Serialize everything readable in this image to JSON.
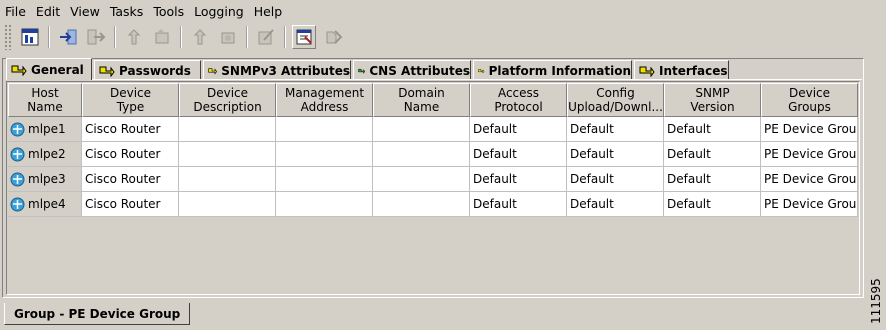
{
  "menu": [
    "File",
    "Edit",
    "View",
    "Tasks",
    "Tools",
    "Logging",
    "Help"
  ],
  "toolbar": {
    "buttons": [
      {
        "icon": "device-properties-icon",
        "enabled": true
      },
      {
        "icon": "import-icon",
        "enabled": true
      },
      {
        "icon": "export-icon",
        "enabled": false
      },
      {
        "icon": "upload-icon",
        "enabled": false
      },
      {
        "icon": "upload-config-icon",
        "enabled": false
      },
      {
        "icon": "deploy-icon",
        "enabled": false
      },
      {
        "icon": "deploy-config-icon",
        "enabled": false
      },
      {
        "icon": "edit-icon",
        "enabled": false
      },
      {
        "icon": "group-properties-icon",
        "enabled": true
      },
      {
        "icon": "collect-icon",
        "enabled": false
      }
    ]
  },
  "tabs": [
    "General",
    "Passwords",
    "SNMPv3 Attributes",
    "CNS Attributes",
    "Platform Information",
    "Interfaces"
  ],
  "selected_tab": "General",
  "table": {
    "headers": [
      [
        "Host",
        "Name"
      ],
      [
        "Device",
        "Type"
      ],
      [
        "Device",
        "Description"
      ],
      [
        "Management",
        "Address"
      ],
      [
        "Domain",
        "Name"
      ],
      [
        "Access",
        "Protocol"
      ],
      [
        "Config",
        "Upload/Downl..."
      ],
      [
        "SNMP",
        "Version"
      ],
      [
        "Device",
        "Groups"
      ]
    ],
    "rows": [
      [
        "mlpe1",
        "Cisco Router",
        "",
        "",
        "",
        "Default",
        "Default",
        "Default",
        "PE Device Group"
      ],
      [
        "mlpe2",
        "Cisco Router",
        "",
        "",
        "",
        "Default",
        "Default",
        "Default",
        "PE Device Group"
      ],
      [
        "mlpe3",
        "Cisco Router",
        "",
        "",
        "",
        "Default",
        "Default",
        "Default",
        "PE Device Group"
      ],
      [
        "mlpe4",
        "Cisco Router",
        "",
        "",
        "",
        "Default",
        "Default",
        "Default",
        "PE Device Group"
      ]
    ]
  },
  "bottom_tab": "Group - PE Device Group",
  "figure_id": "111595",
  "colors": {
    "background": "#d4d0c8",
    "tab_icon_yellow": "#f0e000",
    "tab_icon_green": "#2e9e2e",
    "router_icon": "#3aa0d8"
  }
}
